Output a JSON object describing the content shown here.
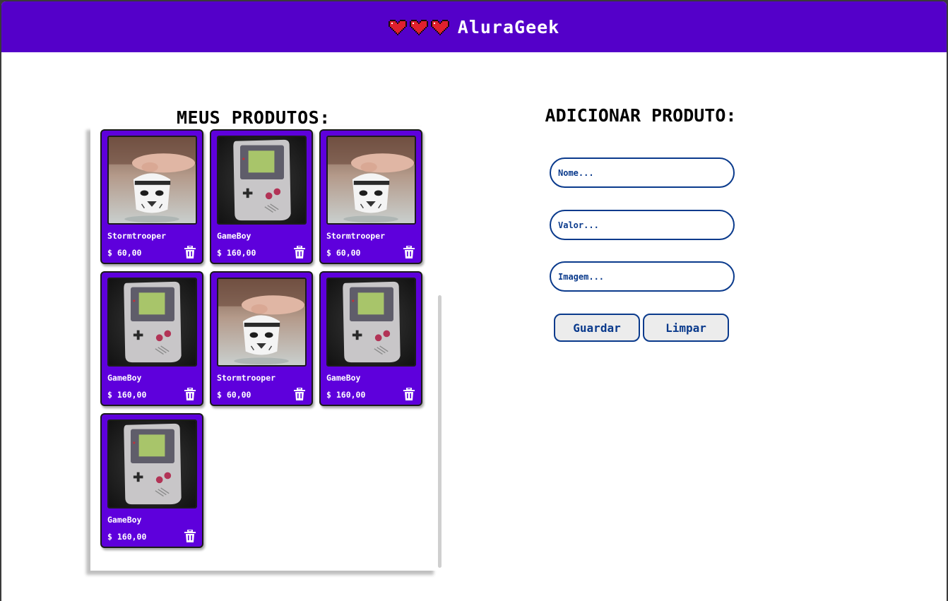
{
  "header": {
    "brand_name": "AluraGeek",
    "colors": {
      "background": "#5400c9",
      "heart": "#e0202e"
    }
  },
  "products": {
    "title": "MEUS PRODUTOS:",
    "items": [
      {
        "name": "",
        "price": "",
        "image": "stormtrooper"
      },
      {
        "name": "",
        "price": "",
        "image": "gameboy"
      },
      {
        "name": "",
        "price": "",
        "image": "stormtrooper"
      },
      {
        "name": "Stormtrooper",
        "price": "$ 60,00",
        "image": "stormtrooper"
      },
      {
        "name": "GameBoy",
        "price": "$ 160,00",
        "image": "gameboy"
      },
      {
        "name": "Stormtrooper",
        "price": "$ 60,00",
        "image": "stormtrooper"
      },
      {
        "name": "GameBoy",
        "price": "$ 160,00",
        "image": "gameboy"
      },
      {
        "name": "Stormtrooper",
        "price": "$ 60,00",
        "image": "stormtrooper"
      },
      {
        "name": "GameBoy",
        "price": "$ 160,00",
        "image": "gameboy"
      },
      {
        "name": "GameBoy",
        "price": "$ 160,00",
        "image": "gameboy"
      }
    ],
    "card_color": "#5e00dc"
  },
  "form": {
    "title": "ADICIONAR PRODUTO:",
    "name_placeholder": "Nome...",
    "value_placeholder": "Valor...",
    "image_placeholder": "Imagem...",
    "save_label": "Guardar",
    "clear_label": "Limpar",
    "accent_color": "#0a3a8c"
  }
}
